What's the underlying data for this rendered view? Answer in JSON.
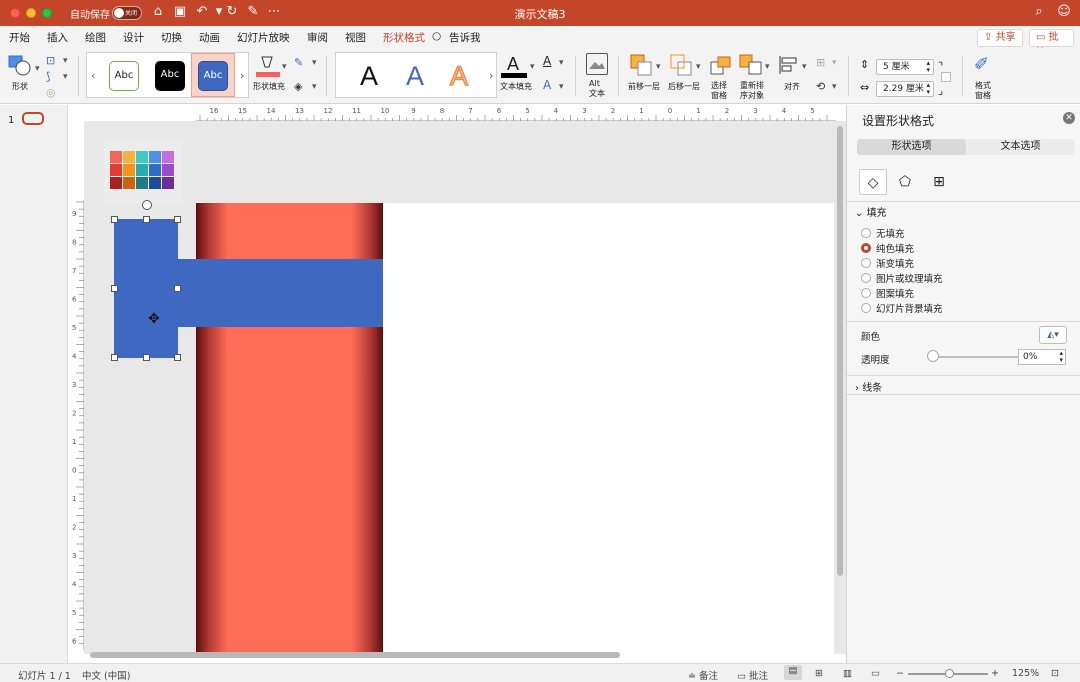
{
  "window": {
    "title": "演示文稿3",
    "autosave_label": "自动保存",
    "autosave_state": "关闭"
  },
  "menu": {
    "tabs": [
      "开始",
      "插入",
      "绘图",
      "设计",
      "切换",
      "动画",
      "幻灯片放映",
      "审阅",
      "视图",
      "形状格式"
    ],
    "active_tab": "形状格式",
    "tell_me": "告诉我",
    "share": "共享",
    "comments": "批注"
  },
  "ribbon": {
    "shape_label": "形状",
    "style_samples": [
      "Abc",
      "Abc",
      "Abc"
    ],
    "shape_fill_label": "形状填充",
    "wordart_letters": [
      "A",
      "A",
      "A"
    ],
    "text_fill_label": "文本填充",
    "alt_text_label": "Alt\n文本",
    "alt_text_line1": "Alt",
    "alt_text_line2": "文本",
    "bring_forward": "前移一层",
    "send_backward": "后移一层",
    "selection_pane_1": "选择",
    "selection_pane_2": "窗格",
    "reorder_1": "重新排",
    "reorder_2": "序对象",
    "align": "对齐",
    "height_value": "5 厘米",
    "width_value": "2.29 厘米",
    "format_pane_1": "格式",
    "format_pane_2": "窗格"
  },
  "thumbnails": {
    "slide_number": "1"
  },
  "ruler": {
    "h_ticks": [
      "16",
      "15",
      "14",
      "13",
      "12",
      "11",
      "10",
      "9",
      "8",
      "7",
      "6",
      "5",
      "4",
      "3",
      "2",
      "1",
      "0",
      "1",
      "2",
      "3",
      "4",
      "5",
      "6"
    ],
    "v_ticks": [
      "9",
      "8",
      "7",
      "6",
      "5",
      "4",
      "3",
      "2",
      "1",
      "0",
      "1",
      "2",
      "3",
      "4",
      "5",
      "6",
      "7"
    ]
  },
  "palette_colors": [
    [
      "#f5645c",
      "#f8b03e",
      "#3fc8c7",
      "#4f8fe6",
      "#c26fe0"
    ],
    [
      "#e53b36",
      "#f39519",
      "#27a9b0",
      "#2f6cc7",
      "#9b4cc9"
    ],
    [
      "#a82121",
      "#c9640f",
      "#1d7c84",
      "#1f4c99",
      "#6f2b98"
    ]
  ],
  "format_pane": {
    "title": "设置形状格式",
    "tab_shape": "形状选项",
    "tab_text": "文本选项",
    "fill_section": "填充",
    "fill_options": [
      "无填充",
      "纯色填充",
      "渐变填充",
      "图片或纹理填充",
      "图案填充",
      "幻灯片背景填充"
    ],
    "selected_fill": "纯色填充",
    "color_label": "颜色",
    "transparency_label": "透明度",
    "transparency_value": "0%",
    "line_section": "线条"
  },
  "status": {
    "slide_info": "幻灯片 1 / 1",
    "language": "中文 (中国)",
    "notes": "备注",
    "comments": "批注",
    "zoom": "125%"
  },
  "colors": {
    "accent": "#c3462a",
    "shape_blue": "#3f69c1",
    "panel_red": "#ff6c58"
  }
}
